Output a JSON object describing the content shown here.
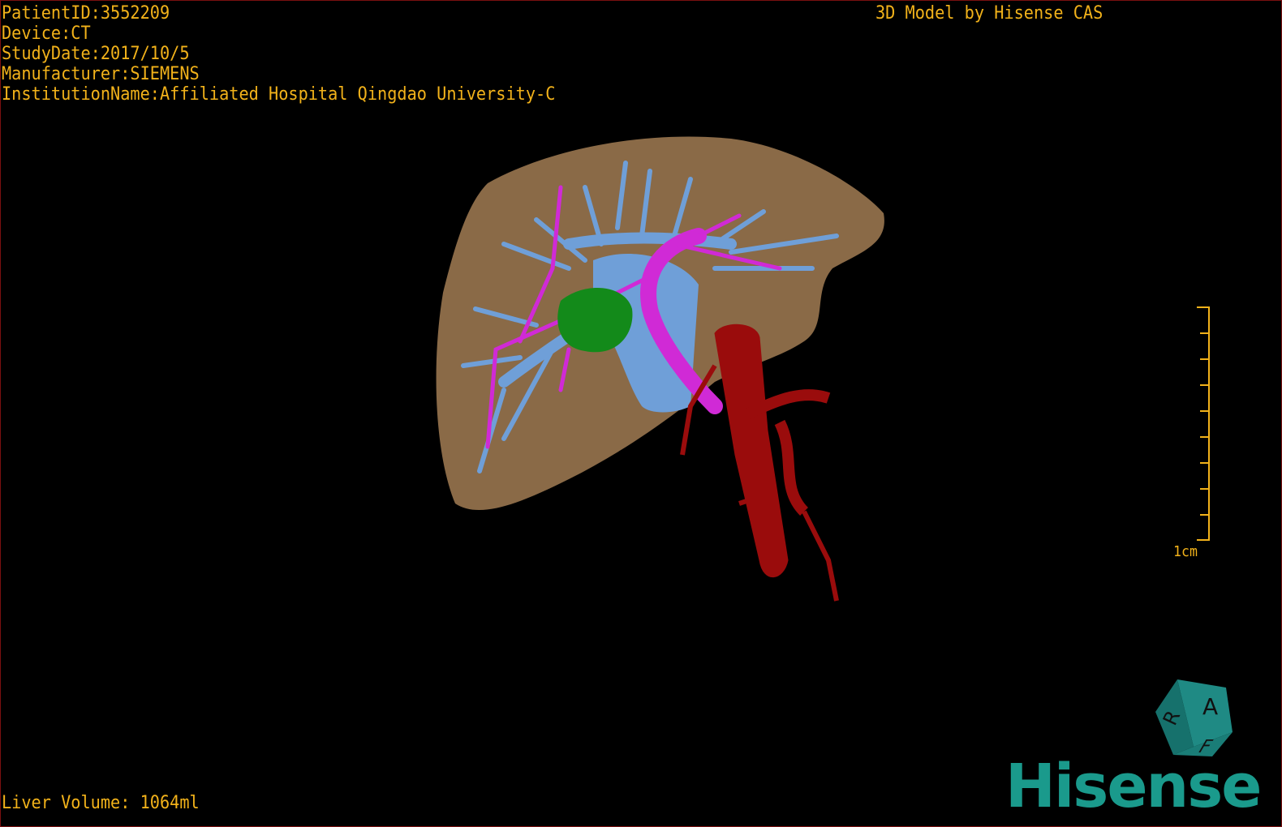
{
  "overlay": {
    "patient_id": "PatientID:3552209",
    "device": "Device:CT",
    "study_date": "StudyDate:2017/10/5",
    "manufacturer": "Manufacturer:SIEMENS",
    "institution": "InstitutionName:Affiliated Hospital Qingdao University-C",
    "title": "3D Model by Hisense CAS",
    "liver_volume": "Liver Volume: 1064ml",
    "scale_label": "1cm"
  },
  "orientation_cube": {
    "faces": [
      "A",
      "R",
      "F"
    ],
    "color": "#1f8a84"
  },
  "logo": {
    "text": "Hisense",
    "color": "#1a9a8c"
  },
  "colors": {
    "text": "#f2b21a",
    "liver": "#8a6a47",
    "hepatic_vein": "#6f9fd8",
    "portal_vein": "#d02ad6",
    "artery": "#9a0c0c",
    "gallbladder": "#138a1a"
  }
}
